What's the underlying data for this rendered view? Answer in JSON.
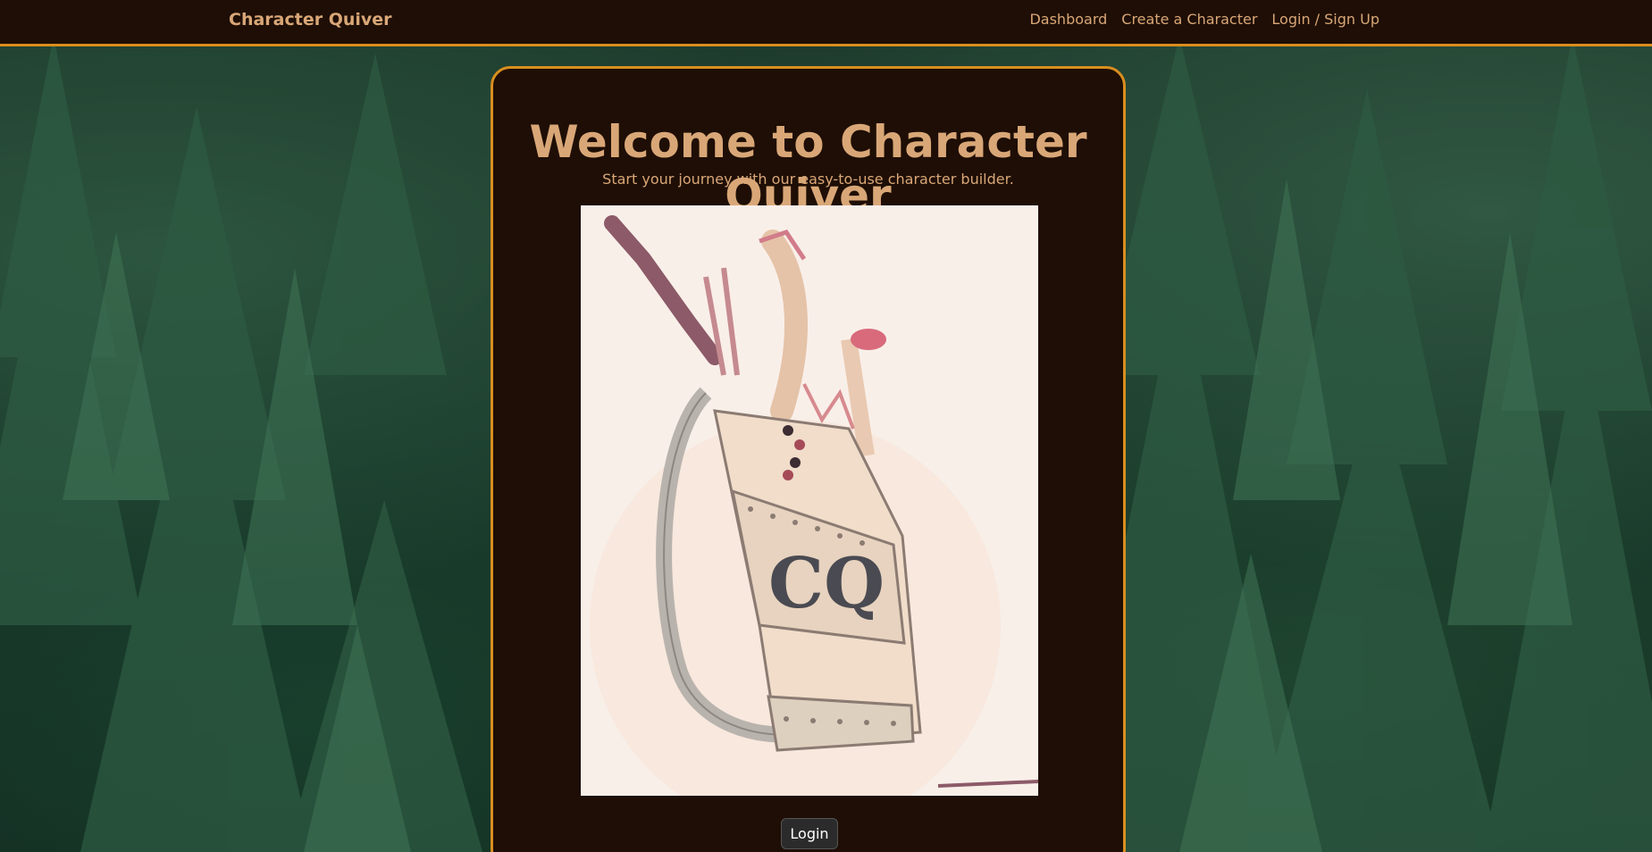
{
  "navbar": {
    "brand": "Character Quiver",
    "links": [
      {
        "label": "Dashboard"
      },
      {
        "label": "Create a Character"
      },
      {
        "label": "Login / Sign Up"
      }
    ]
  },
  "hero": {
    "title": "Welcome to Character Quiver",
    "subtitle": "Start your journey with our easy-to-use character builder.",
    "image_icon": "quiver-illustration",
    "logo_text": "CQ"
  },
  "actions": {
    "login_label": "Login"
  },
  "colors": {
    "accent": "#d98e1f",
    "text": "#d9a777",
    "panel": "#1e0e05"
  }
}
